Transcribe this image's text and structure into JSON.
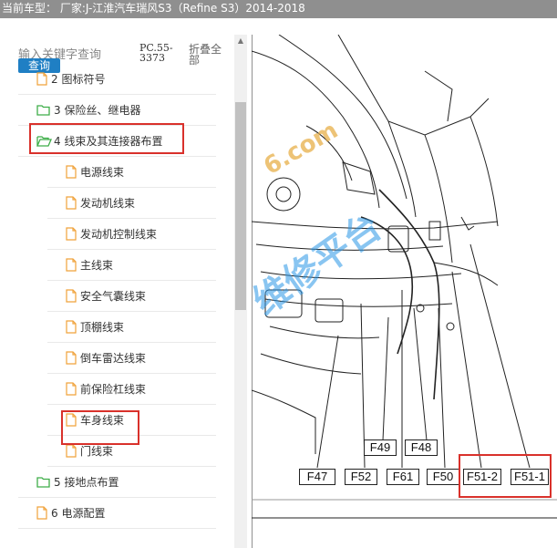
{
  "titlebar": {
    "text": "当前车型： 厂家:J-江淮汽车瑞风S3（Refine S3）2014-2018"
  },
  "search": {
    "placeholder": "输入关键字查询",
    "button_label": "查询",
    "pc_code": "PC.55-3373",
    "fold_all_label": "折叠全部"
  },
  "tree": {
    "items": [
      {
        "label": "2 图标符号",
        "icon": "file-icon"
      },
      {
        "label": "3 保险丝、继电器",
        "icon": "folder-icon"
      },
      {
        "label": "4 线束及其连接器布置",
        "icon": "folder-open-icon",
        "highlighted": true
      },
      {
        "label": "电源线束",
        "icon": "file-icon"
      },
      {
        "label": "发动机线束",
        "icon": "file-icon"
      },
      {
        "label": "发动机控制线束",
        "icon": "file-icon"
      },
      {
        "label": "主线束",
        "icon": "file-icon"
      },
      {
        "label": "安全气囊线束",
        "icon": "file-icon"
      },
      {
        "label": "顶棚线束",
        "icon": "file-icon"
      },
      {
        "label": "倒车雷达线束",
        "icon": "file-icon"
      },
      {
        "label": "前保险杠线束",
        "icon": "file-icon"
      },
      {
        "label": "车身线束",
        "icon": "file-icon",
        "highlighted": true
      },
      {
        "label": "门线束",
        "icon": "file-icon"
      },
      {
        "label": "5 接地点布置",
        "icon": "folder-icon"
      },
      {
        "label": "6 电源配置",
        "icon": "file-icon"
      }
    ]
  },
  "diagram": {
    "watermarks": [
      "6.com",
      "维修平台"
    ],
    "connectors": [
      "F49",
      "F48",
      "F47",
      "F52",
      "F61",
      "F50",
      "F51-2",
      "F51-1"
    ],
    "highlighted_connectors": [
      "F51-2",
      "F51-1"
    ]
  },
  "colors": {
    "accent": "#1f7fc4",
    "highlight": "#d9312b",
    "folder": "#3fae49",
    "file": "#f0a23a",
    "titlebar": "#8f8f8f"
  }
}
